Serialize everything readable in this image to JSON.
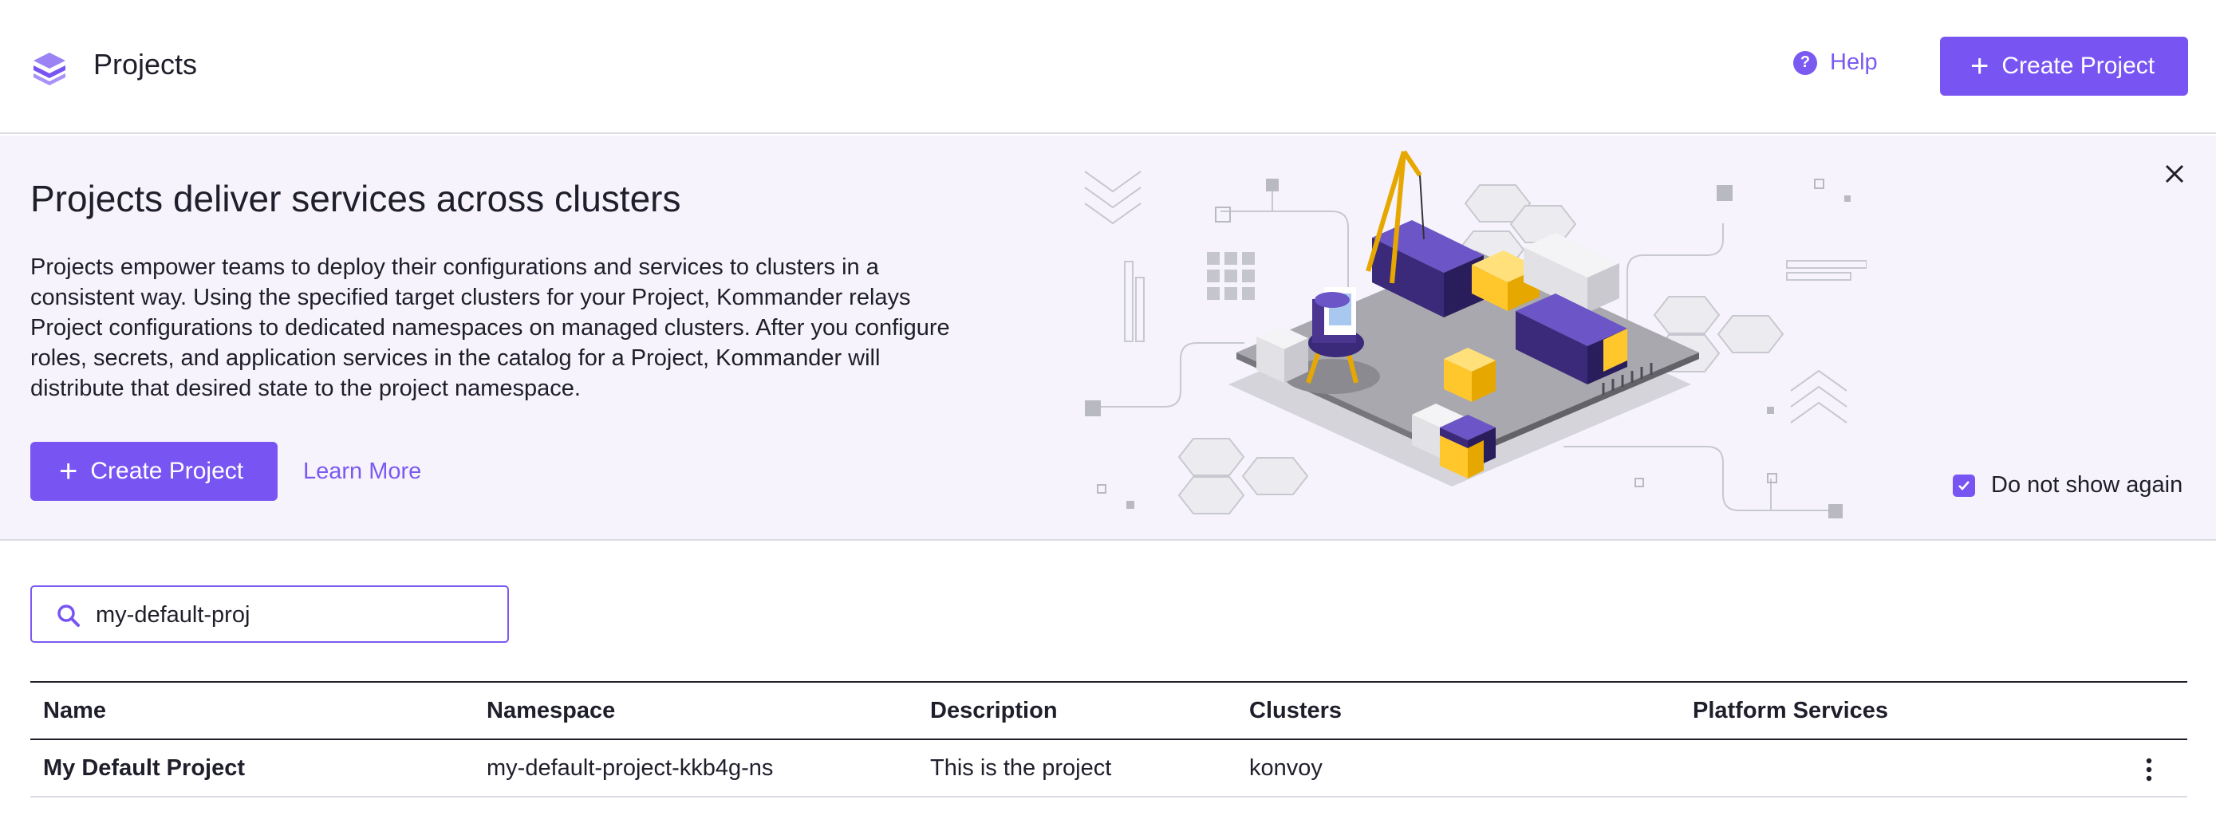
{
  "header": {
    "title": "Projects",
    "help_label": "Help",
    "help_icon": "?",
    "create_label": "Create Project"
  },
  "banner": {
    "title": "Projects deliver services across clusters",
    "description": "Projects empower teams to deploy their configurations and services to clusters in a consistent way. Using the specified target clusters for your Project, Kommander relays Project configurations to dedicated namespaces on managed clusters. After you configure roles, secrets, and application services in the catalog for a Project, Kommander will distribute that desired state to the project namespace.",
    "create_label": "Create Project",
    "learn_more_label": "Learn More",
    "dont_show_label": "Do not show again",
    "dont_show_checked": true
  },
  "search": {
    "value": "my-default-proj"
  },
  "table": {
    "columns": [
      "Name",
      "Namespace",
      "Description",
      "Clusters",
      "Platform Services"
    ],
    "rows": [
      {
        "name": "My Default Project",
        "namespace": "my-default-project-kkb4g-ns",
        "description": "This is the project",
        "clusters": "konvoy",
        "platform_services": ""
      }
    ]
  },
  "colors": {
    "accent": "#7855f2",
    "banner_bg": "#f6f3fd",
    "container_purple": "#3b2a7a",
    "container_yellow": "#ffc72c"
  },
  "icons": {
    "logo": "stacked-layers-icon",
    "help": "question-circle-icon",
    "plus": "plus-icon",
    "close": "close-icon",
    "check": "check-icon",
    "search": "search-icon",
    "kebab": "kebab-menu-icon"
  }
}
